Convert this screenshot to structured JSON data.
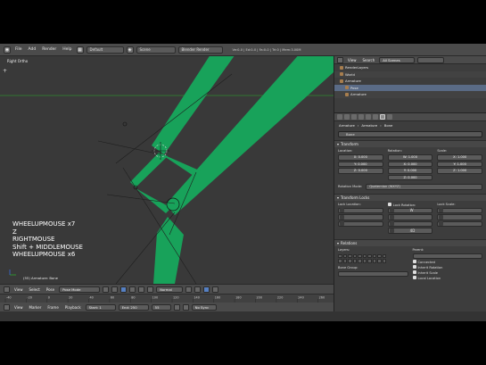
{
  "topbar": {
    "menus": [
      "File",
      "Add",
      "Render",
      "Help"
    ],
    "layout": "Default",
    "scene": "Scene",
    "engine": "Blender Render",
    "stats": "Ve:0-0 | Ed:0-0 | Fa:0-0 | Tri:0 | Mem:3.00M"
  },
  "viewport": {
    "label": "Right Ortho",
    "key_log": [
      "WHEELUPMOUSE x7",
      "Z",
      "RIGHTMOUSE",
      "Shift + MIDDLEMOUSE",
      "WHEELUPMOUSE x6"
    ],
    "object_label": "(55) Armature: Bone"
  },
  "viewport_header": {
    "menus": [
      "View",
      "Select",
      "Pose"
    ],
    "mode": "Pose Mode",
    "orientation": "Normal"
  },
  "timeline": {
    "menus": [
      "View",
      "Marker",
      "Frame",
      "Playback"
    ],
    "start": "Start: 1",
    "end": "End: 250",
    "frame": "55",
    "sync": "No Sync",
    "ticks": [
      "-40",
      "-20",
      "0",
      "20",
      "40",
      "60",
      "80",
      "100",
      "120",
      "140",
      "160",
      "180",
      "200",
      "220",
      "240",
      "260"
    ]
  },
  "outliner": {
    "menus": [
      "View",
      "Search"
    ],
    "filter": "All Scenes",
    "rows": [
      {
        "label": "RenderLayers",
        "indent": 1
      },
      {
        "label": "World",
        "indent": 1
      },
      {
        "label": "Armature",
        "indent": 1
      },
      {
        "label": "Pose",
        "indent": 2
      },
      {
        "label": "Armature",
        "indent": 2
      }
    ]
  },
  "properties": {
    "breadcrumb": [
      "Armature",
      "Armature",
      "Bone"
    ],
    "bone_name": "Bone",
    "transform": {
      "title": "Transform",
      "location_label": "Location:",
      "rotation_label": "Rotation:",
      "scale_label": "Scale:",
      "location": [
        "X: 0.000",
        "Y: 0.000",
        "Z: 0.000"
      ],
      "rotation": [
        "W: 1.000",
        "X: 0.000",
        "Y: 0.000",
        "Z: 0.000"
      ],
      "scale": [
        "X: 1.000",
        "Y: 1.000",
        "Z: 1.000"
      ],
      "rotation_mode_label": "Rotation Mode:",
      "rotation_mode": "Quaternion (WXYZ)"
    },
    "locks": {
      "title": "Transform Locks",
      "location_label": "Lock Location:",
      "rotation_label": "Lock Rotation:",
      "scale_label": "Lock Scale:",
      "rot_w": "W",
      "rot_4d": "4D"
    },
    "relations": {
      "title": "Relations",
      "layers_label": "Layers:",
      "parent_label": "Parent:",
      "bone_group_label": "Bone Group:",
      "options": [
        "Connected",
        "Inherit Rotation",
        "Inherit Scale",
        "Local Location"
      ]
    }
  },
  "colors": {
    "bone_green": "#18a25a",
    "accent_blue": "#5680c2",
    "horizon_green": "#2f8a2f"
  }
}
